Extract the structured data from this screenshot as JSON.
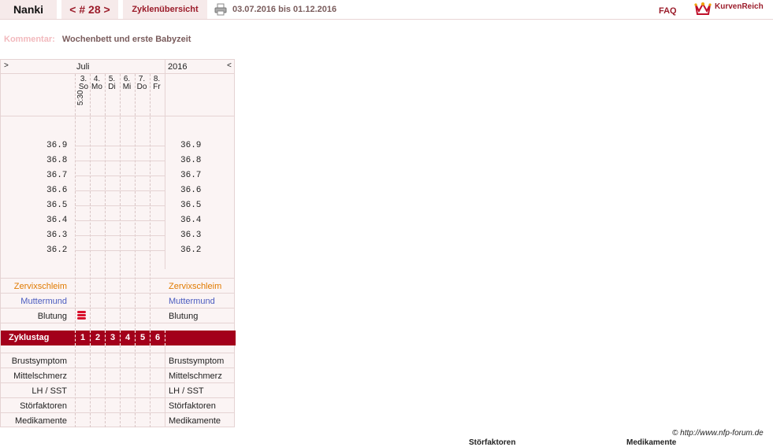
{
  "topbar": {
    "user": "Nanki",
    "cycle": "< # 28 >",
    "overview": "Zyklenübersicht",
    "date_range": "03.07.2016 bis 01.12.2016",
    "faq": "FAQ",
    "logo_text": "KurvenReich"
  },
  "comment": {
    "label": "Kommentar:",
    "value": "Wochenbett und erste Babyzeit"
  },
  "chart": {
    "nav_left": ">",
    "nav_right": "<",
    "month": "Juli",
    "year": "2016",
    "days": [
      {
        "num": "3.",
        "wd": "So"
      },
      {
        "num": "4.",
        "wd": "Mo"
      },
      {
        "num": "5.",
        "wd": "Di"
      },
      {
        "num": "6.",
        "wd": "Mi"
      },
      {
        "num": "7.",
        "wd": "Do"
      },
      {
        "num": "8.",
        "wd": "Fr"
      }
    ],
    "time": "5:30",
    "temps": [
      "36.9",
      "36.8",
      "36.7",
      "36.6",
      "36.5",
      "36.4",
      "36.3",
      "36.2"
    ],
    "rows": {
      "cervix": "Zervixschleim",
      "cervix_color": "#e07a00",
      "muttermund": "Muttermund",
      "muttermund_color": "#4a5bbf",
      "blutung": "Blutung"
    },
    "cycle_day_label": "Zyklustag",
    "cycle_days": [
      "1",
      "2",
      "3",
      "4",
      "5",
      "6"
    ],
    "cycle_bar_color": "#a3001b",
    "bottom_rows": [
      "Brustsymptom",
      "Mittelschmerz",
      "LH / SST",
      "Störfaktoren",
      "Medikamente"
    ]
  },
  "footer": {
    "copyright": "© http://www.nfp-forum.de",
    "cut1": "Störfaktoren",
    "cut2": "Medikamente"
  }
}
